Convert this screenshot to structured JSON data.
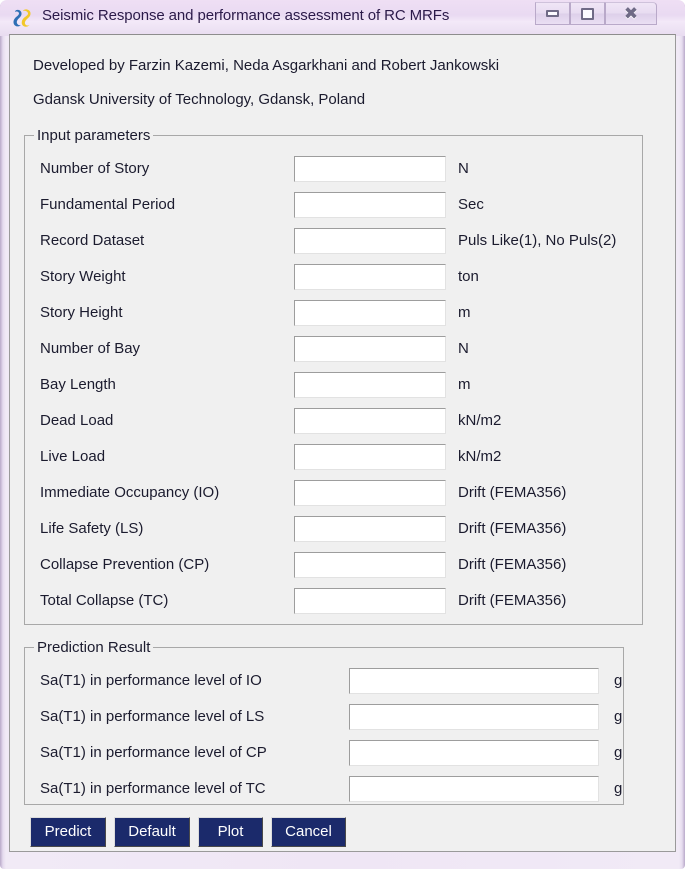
{
  "window": {
    "title": "Seismic Response and performance assessment of RC MRFs",
    "icon": "app-logo-icon",
    "controls": {
      "minimize": "minimize-icon",
      "maximize": "maximize-icon",
      "close": "close-icon"
    },
    "frame_color": "#efe6f5",
    "client_bg": "#f0f0f0"
  },
  "header": {
    "line1": "Developed by Farzin Kazemi, Neda Asgarkhani and Robert Jankowski",
    "line2": "Gdansk University of Technology, Gdansk, Poland"
  },
  "input_group": {
    "title": "Input parameters",
    "rows": [
      {
        "label": "Number of Story",
        "value": "",
        "unit": "N"
      },
      {
        "label": "Fundamental Period",
        "value": "",
        "unit": "Sec"
      },
      {
        "label": "Record Dataset",
        "value": "",
        "unit": "Puls Like(1), No Puls(2)"
      },
      {
        "label": "Story Weight",
        "value": "",
        "unit": "ton"
      },
      {
        "label": "Story Height",
        "value": "",
        "unit": "m"
      },
      {
        "label": "Number of Bay",
        "value": "",
        "unit": "N"
      },
      {
        "label": "Bay Length",
        "value": "",
        "unit": "m"
      },
      {
        "label": "Dead Load",
        "value": "",
        "unit": "kN/m2"
      },
      {
        "label": "Live Load",
        "value": "",
        "unit": "kN/m2"
      },
      {
        "label": "Immediate Occupancy (IO)",
        "value": "",
        "unit": "Drift (FEMA356)"
      },
      {
        "label": "Life Safety (LS)",
        "value": "",
        "unit": "Drift (FEMA356)"
      },
      {
        "label": "Collapse Prevention (CP)",
        "value": "",
        "unit": "Drift (FEMA356)"
      },
      {
        "label": "Total Collapse (TC)",
        "value": "",
        "unit": "Drift (FEMA356)"
      }
    ]
  },
  "result_group": {
    "title": "Prediction Result",
    "rows": [
      {
        "label": "Sa(T1) in performance level of IO",
        "value": "",
        "unit": "g"
      },
      {
        "label": "Sa(T1) in performance level of LS",
        "value": "",
        "unit": "g"
      },
      {
        "label": "Sa(T1) in performance level of CP",
        "value": "",
        "unit": "g"
      },
      {
        "label": "Sa(T1) in performance level of TC",
        "value": "",
        "unit": "g"
      }
    ]
  },
  "buttons": {
    "color": "#1b2a6b",
    "items": [
      {
        "label": "Predict",
        "name": "predict-button"
      },
      {
        "label": "Default",
        "name": "default-button"
      },
      {
        "label": "Plot",
        "name": "plot-button"
      },
      {
        "label": "Cancel",
        "name": "cancel-button"
      }
    ]
  }
}
